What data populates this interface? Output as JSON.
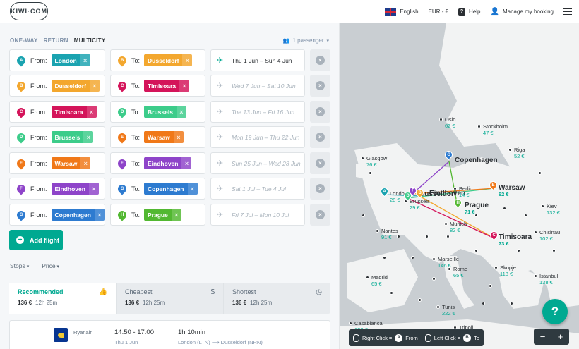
{
  "header": {
    "logo": "KIWI·COM",
    "language": "English",
    "currency": "EUR - €",
    "help": "Help",
    "manage": "Manage my booking"
  },
  "search": {
    "trip_types": [
      "ONE-WAY",
      "RETURN",
      "MULTICITY"
    ],
    "passengers": "1 passenger",
    "from_label": "From:",
    "to_label": "To:",
    "legs": [
      {
        "from_letter": "A",
        "from": "London",
        "from_color": "#1aa3b0",
        "to_letter": "B",
        "to": "Dusseldorf",
        "to_color": "#f3a72e",
        "dates": "Thu 1 Jun – Sun 4 Jun",
        "active": true
      },
      {
        "from_letter": "B",
        "from": "Dusseldorf",
        "from_color": "#f3a72e",
        "to_letter": "C",
        "to": "Timisoara",
        "to_color": "#d4145a",
        "dates": "Wed 7 Jun – Sat 10 Jun",
        "active": false
      },
      {
        "from_letter": "C",
        "from": "Timisoara",
        "from_color": "#d4145a",
        "to_letter": "D",
        "to": "Brussels",
        "to_color": "#3ccc8a",
        "dates": "Tue 13 Jun – Fri 16 Jun",
        "active": false
      },
      {
        "from_letter": "D",
        "from": "Brussels",
        "from_color": "#3ccc8a",
        "to_letter": "E",
        "to": "Warsaw",
        "to_color": "#f07818",
        "dates": "Mon 19 Jun – Thu 22 Jun",
        "active": false
      },
      {
        "from_letter": "E",
        "from": "Warsaw",
        "from_color": "#f07818",
        "to_letter": "F",
        "to": "Eindhoven",
        "to_color": "#8e44c9",
        "dates": "Sun 25 Jun – Wed 28 Jun",
        "active": false
      },
      {
        "from_letter": "F",
        "from": "Eindhoven",
        "from_color": "#8e44c9",
        "to_letter": "G",
        "to": "Copenhagen",
        "to_color": "#2d7bd0",
        "dates": "Sat 1 Jul – Tue 4 Jul",
        "active": false
      },
      {
        "from_letter": "G",
        "from": "Copenhagen",
        "from_color": "#2d7bd0",
        "to_letter": "H",
        "to": "Prague",
        "to_color": "#52b831",
        "dates": "Fri 7 Jul – Mon 10 Jul",
        "active": false
      }
    ],
    "add_flight": "Add flight"
  },
  "filters": {
    "stops": "Stops",
    "price": "Price"
  },
  "sort": [
    {
      "title": "Recommended",
      "price": "136 €",
      "duration": "12h 25m",
      "icon": "thumbs-up-icon",
      "active": true
    },
    {
      "title": "Cheapest",
      "price": "136 €",
      "duration": "12h 25m",
      "icon": "dollar-icon",
      "active": false
    },
    {
      "title": "Shortest",
      "price": "136 €",
      "duration": "12h 25m",
      "icon": "clock-icon",
      "active": false
    }
  ],
  "result": {
    "airline": "Ryanair",
    "time": "14:50 - 17:00",
    "date": "Thu 1 Jun",
    "duration": "1h 10min",
    "route_from": "London (LTN)",
    "route_to": "Dusseldorf (NRN)"
  },
  "map": {
    "cities": [
      {
        "name": "Oslo",
        "price": "62 €"
      },
      {
        "name": "Stockholm",
        "price": "47 €"
      },
      {
        "name": "Riga",
        "price": "52 €"
      },
      {
        "name": "Glasgow",
        "price": "76 €"
      },
      {
        "name": "Copenhagen",
        "price": ""
      },
      {
        "name": "London",
        "price": "28 €"
      },
      {
        "name": "Eindhoven",
        "price": ""
      },
      {
        "name": "Brussels",
        "price": "29 €"
      },
      {
        "name": "Dusseldorf",
        "price": ""
      },
      {
        "name": "Berlin",
        "price": "14 €"
      },
      {
        "name": "Warsaw",
        "price": "62 €"
      },
      {
        "name": "Prague",
        "price": "71 €"
      },
      {
        "name": "Kiev",
        "price": "132 €"
      },
      {
        "name": "Nantes",
        "price": "91 €"
      },
      {
        "name": "Munich",
        "price": "82 €"
      },
      {
        "name": "Timisoara",
        "price": "73 €"
      },
      {
        "name": "Chisinau",
        "price": "102 €"
      },
      {
        "name": "Marseille",
        "price": "146 €"
      },
      {
        "name": "Rome",
        "price": "65 €"
      },
      {
        "name": "Skopje",
        "price": "118 €"
      },
      {
        "name": "Istanbul",
        "price": "138 €"
      },
      {
        "name": "Madrid",
        "price": "65 €"
      },
      {
        "name": "Tunis",
        "price": "222 €"
      },
      {
        "name": "Casablanca",
        "price": "128 €"
      },
      {
        "name": "Tripoli",
        "price": ""
      }
    ],
    "help_label": "?",
    "zoom_out": "−",
    "zoom_in": "+",
    "hint_right_click": "Right Click =",
    "hint_from": "From",
    "hint_left_click": "Left Click =",
    "hint_to": "To",
    "hint_from_letter": "A",
    "hint_to_letter": "B"
  }
}
